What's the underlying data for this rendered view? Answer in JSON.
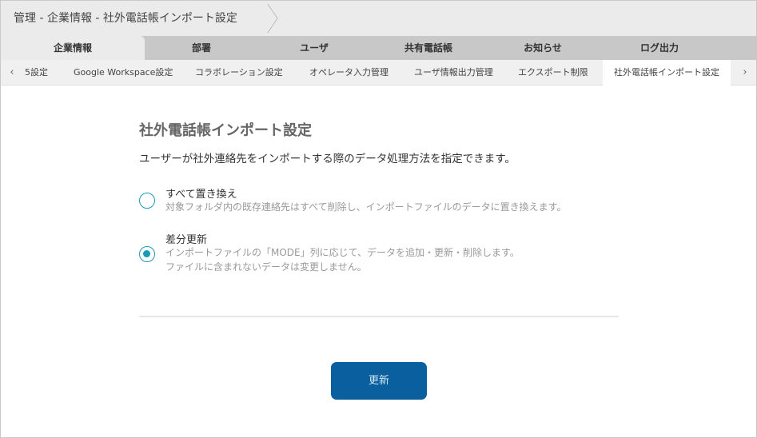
{
  "breadcrumb": "管理 - 企業情報 - 社外電話帳インポート設定",
  "main_tabs": [
    "企業情報",
    "部署",
    "ユーザ",
    "共有電話帳",
    "お知らせ",
    "ログ出力"
  ],
  "sub_tabs": [
    "5設定",
    "Google Workspace設定",
    "コラボレーション設定",
    "オペレータ入力管理",
    "ユーザ情報出力管理",
    "エクスポート制限",
    "社外電話帳インポート設定"
  ],
  "page": {
    "title": "社外電話帳インポート設定",
    "description": "ユーザーが社外連絡先をインポートする際のデータ処理方法を指定できます。",
    "options": [
      {
        "label": "すべて置き換え",
        "desc1": "対象フォルダ内の既存連絡先はすべて削除し、インポートファイルのデータに置き換えます。",
        "desc2": "",
        "selected": false
      },
      {
        "label": "差分更新",
        "desc1": "インポートファイルの「MODE」列に応じて、データを追加・更新・削除します。",
        "desc2": "ファイルに含まれないデータは変更しません。",
        "selected": true
      }
    ],
    "submit": "更新"
  },
  "colors": {
    "accent": "#1a9bb5",
    "button": "#0a609e"
  }
}
